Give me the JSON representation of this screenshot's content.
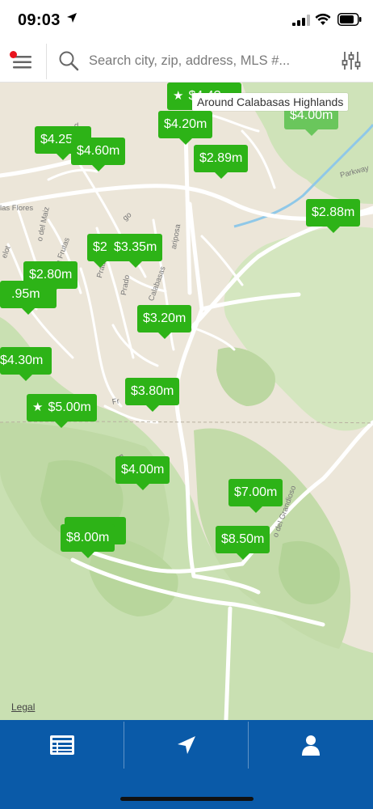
{
  "status": {
    "time": "09:03"
  },
  "search": {
    "placeholder": "Search city, zip, address, MLS #..."
  },
  "map": {
    "area_label": "Around Calabasas Highlands",
    "legal": "Legal",
    "road_labels": [
      "las Flores",
      "o del Maiz",
      "la Frutas",
      "Prado",
      "Prado",
      "Calabasas",
      "ariposa",
      "Parkway",
      "Fr",
      "P",
      "o del Grandioso",
      "elot",
      "go",
      "d"
    ],
    "pins": [
      {
        "label": "$4.4?",
        "star": true
      },
      {
        "label": "$4.00m",
        "light": true
      },
      {
        "label": "$4.20m"
      },
      {
        "label": "$4.25"
      },
      {
        "label": "$4.60m"
      },
      {
        "label": "$2.89m"
      },
      {
        "label": "$2.88m"
      },
      {
        "label": "$2"
      },
      {
        "label": "$3.35m"
      },
      {
        "label": "$2.80m"
      },
      {
        "label": ".95m"
      },
      {
        "label": "$3.20m"
      },
      {
        "label": "$4.30m"
      },
      {
        "label": "$3.80m"
      },
      {
        "label": "$5.00m",
        "star": true
      },
      {
        "label": "$4.00m"
      },
      {
        "label": "$7.00m"
      },
      {
        "label": "$8.00m"
      },
      {
        "label": "$8.50m"
      }
    ]
  },
  "nav": [
    "listings-icon",
    "navigation-arrow-icon",
    "profile-icon"
  ],
  "colors": {
    "pin": "#2db317",
    "pin_light": "#6ac65c",
    "nav": "#0a5aa8",
    "notification": "#e8141e"
  }
}
